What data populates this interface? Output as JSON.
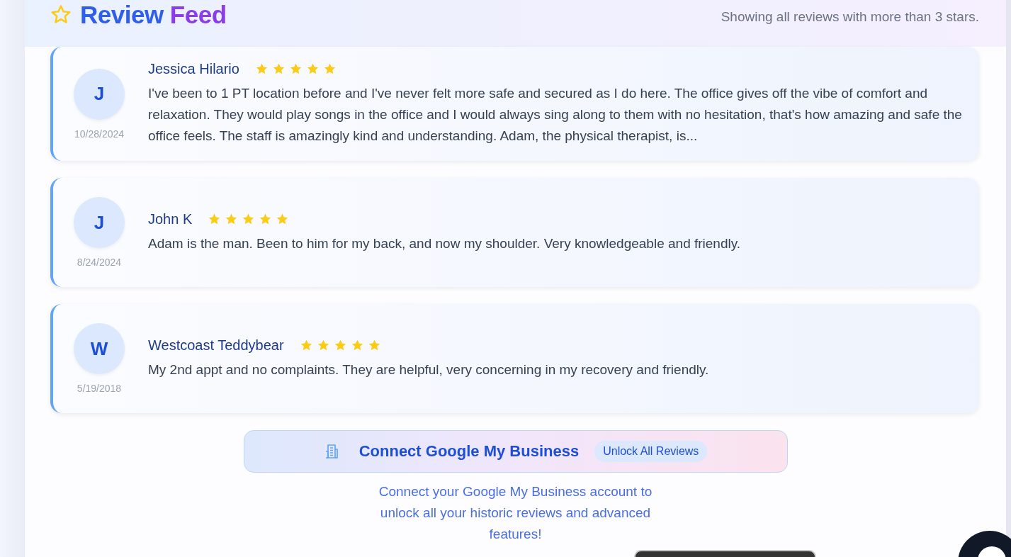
{
  "header": {
    "title_part1": "Review",
    "title_part2": "Feed",
    "subtitle": "Showing all reviews with more than 3 stars."
  },
  "reviews": [
    {
      "initial": "J",
      "date": "10/28/2024",
      "name": "Jessica Hilario",
      "stars": 5,
      "text": "I've been to 1 PT location before and I've never felt more safe and secured as I do here. The office gives off the vibe of comfort and relaxation. They would play songs in the office and I would always sing along to them with no hesitation, that's how amazing and safe the office feels. The staff is amazingly kind and understanding. Adam, the physical therapist, is..."
    },
    {
      "initial": "J",
      "date": "8/24/2024",
      "name": "John K",
      "stars": 5,
      "text": "Adam is the man. Been to him for my back, and now my shoulder. Very knowledgeable and friendly."
    },
    {
      "initial": "W",
      "date": "5/19/2018",
      "name": "Westcoast Teddybear",
      "stars": 5,
      "text": "My 2nd appt and no complaints. They are helpful, very concerning in my recovery and friendly."
    }
  ],
  "connect": {
    "label": "Connect Google My Business",
    "badge": "Unlock All Reviews",
    "description": "Connect your Google My Business account to unlock all your historic reviews and advanced features!"
  }
}
